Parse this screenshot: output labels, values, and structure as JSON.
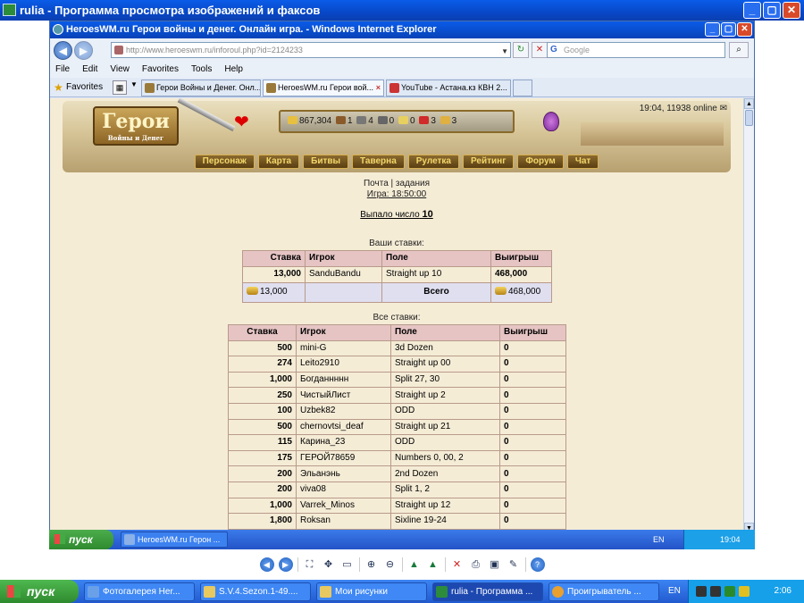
{
  "viewer": {
    "title": "rulia - Программа просмотра изображений и факсов",
    "minimize": "_",
    "maximize": "▢",
    "close": "✕"
  },
  "ie": {
    "title": "HeroesWM.ru Герои войны и денег. Онлайн игра. - Windows Internet Explorer",
    "back": "◀",
    "forward": "▶",
    "url": "http://www.heroeswm.ru/inforoul.php?id=2124233",
    "search_placeholder": "Google",
    "menu": [
      "File",
      "Edit",
      "View",
      "Favorites",
      "Tools",
      "Help"
    ],
    "favorites_label": "Favorites",
    "tabs": [
      {
        "label": "Герои Войны и Денег. Онл..."
      },
      {
        "label": "HeroesWM.ru Герои вой..."
      },
      {
        "label": "YouTube - Астана.кз КВН 2..."
      }
    ]
  },
  "game": {
    "logo": "Герои",
    "logo_sub": "Войны и Денег",
    "time_online": "19:04, 11938 online",
    "resources": [
      "867,304",
      "1",
      "4",
      "0",
      "0",
      "3",
      "3"
    ],
    "nav": [
      "Персонаж",
      "Карта",
      "Битвы",
      "Таверна",
      "Рулетка",
      "Рейтинг",
      "Форум",
      "Чат"
    ],
    "mail": "Почта",
    "tasks": "задания",
    "game_time": "Игра: 18:50:00",
    "dropped_prefix": "Выпало число",
    "dropped_number": "10",
    "my_bets_caption": "Ваши ставки:",
    "all_bets_caption": "Все ставки:",
    "headers": [
      "Ставка",
      "Игрок",
      "Поле",
      "Выигрыш"
    ],
    "my_bets": [
      {
        "bet": "13,000",
        "player": "SanduBandu",
        "field": "Straight up 10",
        "win": "468,000"
      }
    ],
    "total": {
      "bet": "13,000",
      "label": "Всего",
      "win": "468,000"
    },
    "all_bets": [
      {
        "bet": "500",
        "player": "mini-G",
        "field": "3d Dozen",
        "win": "0"
      },
      {
        "bet": "274",
        "player": "Leito2910",
        "field": "Straight up 00",
        "win": "0"
      },
      {
        "bet": "1,000",
        "player": "Богданнннн",
        "field": "Split 27, 30",
        "win": "0"
      },
      {
        "bet": "250",
        "player": "ЧистыйЛист",
        "field": "Straight up 2",
        "win": "0"
      },
      {
        "bet": "100",
        "player": "Uzbek82",
        "field": "ODD",
        "win": "0"
      },
      {
        "bet": "500",
        "player": "chernovtsi_deaf",
        "field": "Straight up 21",
        "win": "0"
      },
      {
        "bet": "115",
        "player": "Карина_23",
        "field": "ODD",
        "win": "0"
      },
      {
        "bet": "175",
        "player": "ГЕРОЙ78659",
        "field": "Numbers 0, 00, 2",
        "win": "0"
      },
      {
        "bet": "200",
        "player": "Эльанэнь",
        "field": "2nd Dozen",
        "win": "0"
      },
      {
        "bet": "200",
        "player": "viva08",
        "field": "Split 1, 2",
        "win": "0"
      },
      {
        "bet": "1,000",
        "player": "Varrek_Minos",
        "field": "Straight up 12",
        "win": "0"
      },
      {
        "bet": "1,800",
        "player": "Roksan",
        "field": "Sixline 19-24",
        "win": "0"
      }
    ]
  },
  "inner_taskbar": {
    "start": "пуск",
    "task": "HeroesWM.ru Герон ...",
    "lang": "EN",
    "time": "19:04"
  },
  "taskbar": {
    "start": "пуск",
    "tasks": [
      "Фотогалерея Her...",
      "S.V.4.Sezon.1-49....",
      "Мои рисунки",
      "rulia - Программа ...",
      "Проигрыватель ..."
    ],
    "lang": "EN",
    "time": "2:06"
  }
}
